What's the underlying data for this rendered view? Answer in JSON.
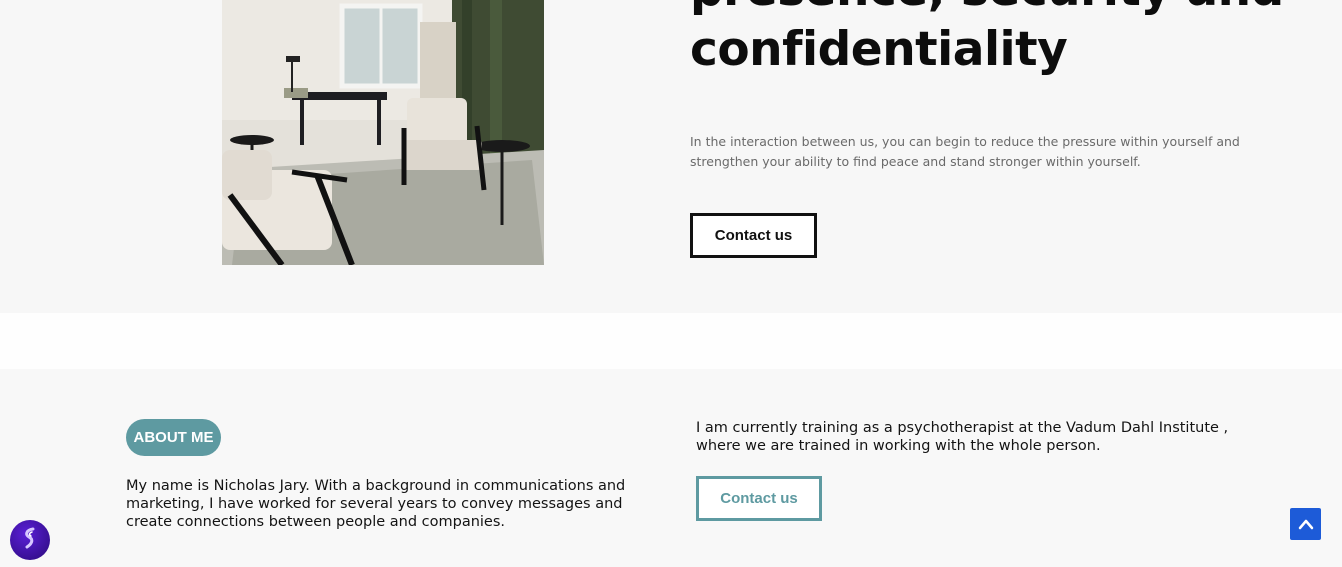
{
  "hero": {
    "title": "presence, security and confidentiality",
    "text": "In the interaction between us, you can begin to reduce the pressure within yourself and strengthen your ability to find peace and stand stronger within yourself.",
    "contact_label": "Contact us"
  },
  "about": {
    "badge": "ABOUT ME",
    "left_text": "My name is Nicholas Jary. With a background in communications and marketing, I have worked for several years to convey messages and create connections between people and companies.",
    "right_text": "I am currently training as a psychotherapist at the Vadum Dahl Institute , where we are trained in working with the whole person.",
    "contact_label": "Contact us"
  },
  "widgets": {
    "chat_icon": "chat-widget-icon",
    "scroll_top_icon": "chevron-up-icon",
    "accent": "#5e9aa1",
    "scroll_color": "#1d5bd8"
  }
}
